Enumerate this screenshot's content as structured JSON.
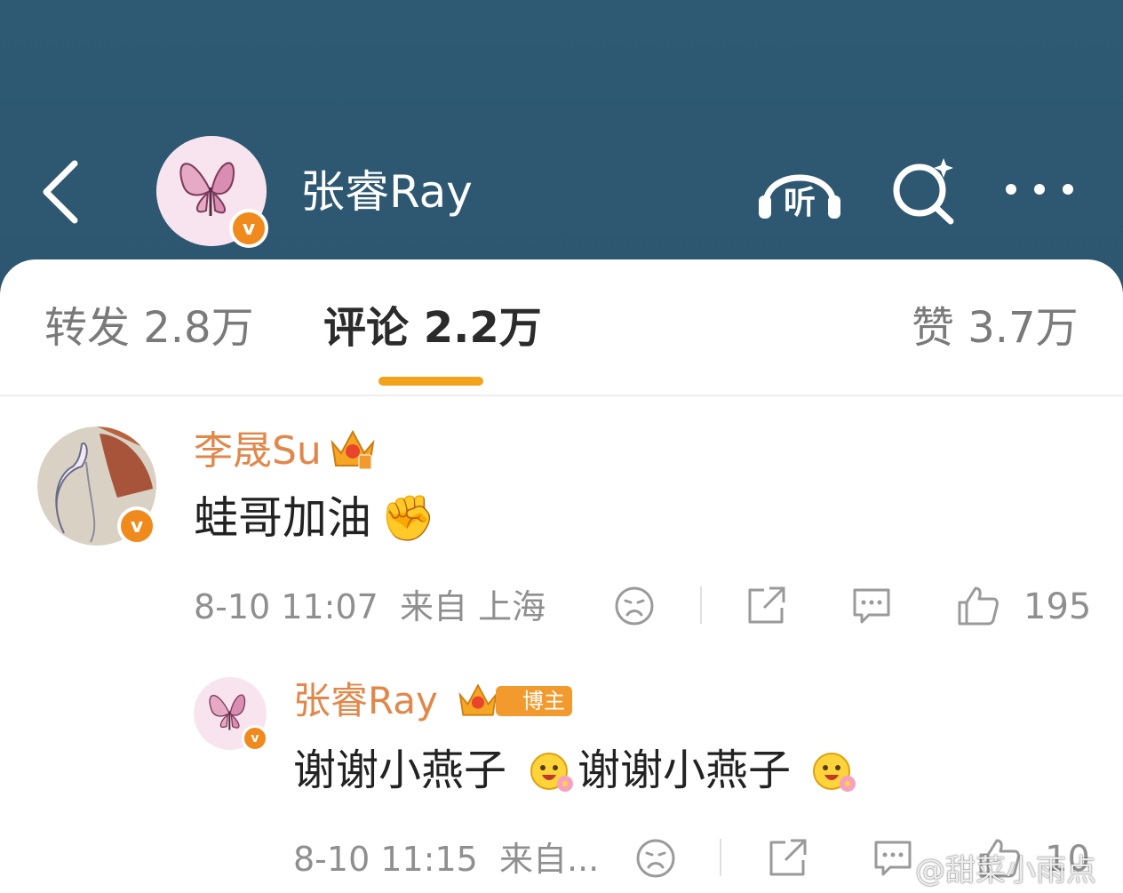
{
  "header": {
    "title": "张睿Ray",
    "colors": {
      "background": "#2f5a74",
      "text": "#ffffff"
    },
    "icons": [
      "back-arrow-icon",
      "listen-headphones-icon",
      "search-icon",
      "more-icon"
    ],
    "listen_label": "听"
  },
  "tabs": [
    {
      "label": "转发 2.8万",
      "active": false
    },
    {
      "label": "评论 2.2万",
      "active": true
    },
    {
      "label": "赞 3.7万",
      "active": false
    }
  ],
  "accent_color": "#f2a21b",
  "comments": [
    {
      "username": "李晟Su",
      "verified": true,
      "text": "蛙哥加油",
      "emoji": "✊",
      "time": "8-10 11:07",
      "location": "来自 上海",
      "likes": "195",
      "username_color": "#e2874a"
    }
  ],
  "reply": {
    "username": "张睿Ray",
    "badge": "博主",
    "verified": true,
    "text": "谢谢小燕子",
    "text2": "谢谢小燕子",
    "time": "8-10 11:15",
    "location": "来自...",
    "likes": "10"
  },
  "watermark": "@甜菜小雨点"
}
